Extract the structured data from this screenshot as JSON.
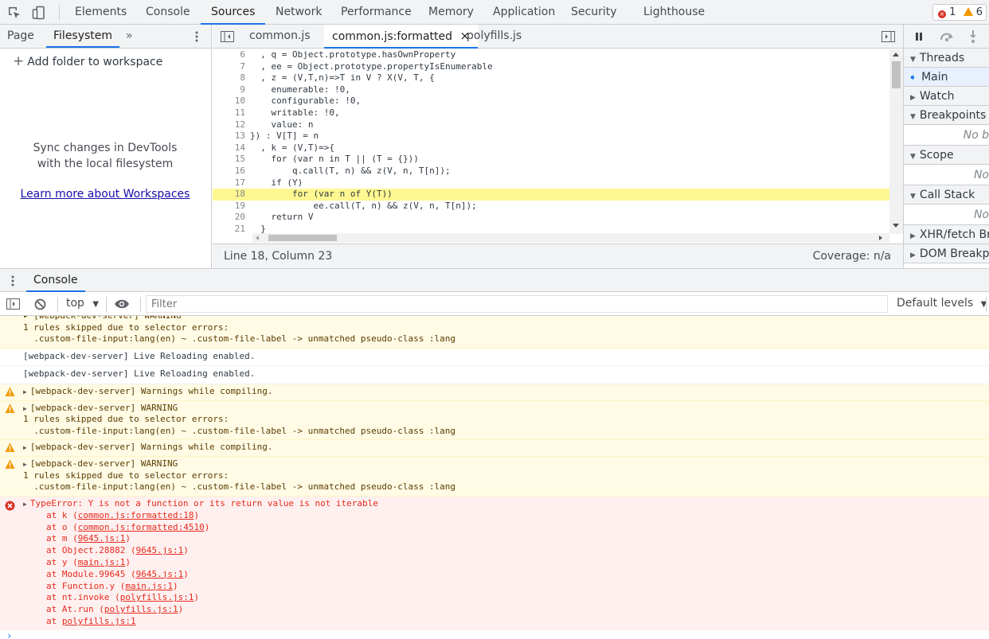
{
  "top_tabs": [
    "Elements",
    "Console",
    "Sources",
    "Network",
    "Performance",
    "Memory",
    "Application",
    "Security",
    "Lighthouse"
  ],
  "issues": {
    "errors": "1",
    "warnings": "6"
  },
  "navigator": {
    "tabs": [
      "Page",
      "Filesystem"
    ],
    "more": "»",
    "add_folder": "Add folder to workspace",
    "sync_line1": "Sync changes in DevTools",
    "sync_line2": "with the local filesystem",
    "learn_more": "Learn more about Workspaces"
  },
  "editor": {
    "tabs": [
      "common.js",
      "common.js:formatted",
      "polyfills.js"
    ],
    "close_glyph": "×",
    "highlighted_line": "18",
    "lines": [
      {
        "n": "6",
        "code": "  , q = Object.prototype.hasOwnProperty"
      },
      {
        "n": "7",
        "code": "  , ee = Object.prototype.propertyIsEnumerable"
      },
      {
        "n": "8",
        "code": "  , z = (V,T,n)=>T in V ? X(V, T, {"
      },
      {
        "n": "9",
        "code": "    enumerable: !0,"
      },
      {
        "n": "10",
        "code": "    configurable: !0,"
      },
      {
        "n": "11",
        "code": "    writable: !0,"
      },
      {
        "n": "12",
        "code": "    value: n"
      },
      {
        "n": "13",
        "code": "}) : V[T] = n"
      },
      {
        "n": "14",
        "code": "  , k = (V,T)=>{"
      },
      {
        "n": "15",
        "code": "    for (var n in T || (T = {}))"
      },
      {
        "n": "16",
        "code": "        q.call(T, n) && z(V, n, T[n]);"
      },
      {
        "n": "17",
        "code": "    if (Y)"
      },
      {
        "n": "18",
        "code": "        for (var n of Y(T))"
      },
      {
        "n": "19",
        "code": "            ee.call(T, n) && z(V, n, T[n]);"
      },
      {
        "n": "20",
        "code": "    return V"
      },
      {
        "n": "21",
        "code": "  }"
      }
    ],
    "status_position": "Line 18, Column 23",
    "coverage": "Coverage: n/a"
  },
  "debugger": {
    "sections": [
      {
        "title": "Threads",
        "expanded": true,
        "body": "Main"
      },
      {
        "title": "Watch",
        "expanded": false,
        "body": ""
      },
      {
        "title": "Breakpoints",
        "expanded": true,
        "body": "No b"
      },
      {
        "title": "Scope",
        "expanded": true,
        "body": "No"
      },
      {
        "title": "Call Stack",
        "expanded": true,
        "body": "No"
      },
      {
        "title": "XHR/fetch Br",
        "expanded": false,
        "body": ""
      },
      {
        "title": "DOM Breakpo",
        "expanded": false,
        "body": ""
      }
    ]
  },
  "drawer": {
    "tab": "Console"
  },
  "console_toolbar": {
    "context": "top",
    "filter_placeholder": "Filter",
    "levels": "Default levels"
  },
  "messages": [
    {
      "level": "warn",
      "icon": false,
      "lines": [
        "▸ [webpack-dev-server] WARNING",
        "1 rules skipped due to selector errors:",
        "  .custom-file-input:lang(en) ~ .custom-file-label -> unmatched pseudo-class :lang"
      ]
    },
    {
      "level": "log",
      "lines": [
        "[webpack-dev-server] Live Reloading enabled."
      ]
    },
    {
      "level": "log",
      "lines": [
        "[webpack-dev-server] Live Reloading enabled."
      ]
    },
    {
      "level": "warn",
      "icon": true,
      "lines": [
        "[webpack-dev-server] Warnings while compiling."
      ]
    },
    {
      "level": "warn",
      "icon": true,
      "lines": [
        "[webpack-dev-server] WARNING",
        "1 rules skipped due to selector errors:",
        "  .custom-file-input:lang(en) ~ .custom-file-label -> unmatched pseudo-class :lang"
      ]
    },
    {
      "level": "warn",
      "icon": true,
      "lines": [
        "[webpack-dev-server] Warnings while compiling."
      ]
    },
    {
      "level": "warn",
      "icon": true,
      "lines": [
        "[webpack-dev-server] WARNING",
        "1 rules skipped due to selector errors:",
        "  .custom-file-input:lang(en) ~ .custom-file-label -> unmatched pseudo-class :lang"
      ]
    }
  ],
  "error": {
    "message": "TypeError: Y is not a function or its return value is not iterable",
    "stack": [
      {
        "at": "at k (",
        "link": "common.js:formatted:18",
        "end": ")"
      },
      {
        "at": "at o (",
        "link": "common.js:formatted:4510",
        "end": ")"
      },
      {
        "at": "at m (",
        "link": "9645.js:1",
        "end": ")"
      },
      {
        "at": "at Object.28882 (",
        "link": "9645.js:1",
        "end": ")"
      },
      {
        "at": "at y (",
        "link": "main.js:1",
        "end": ")"
      },
      {
        "at": "at Module.99645 (",
        "link": "9645.js:1",
        "end": ")"
      },
      {
        "at": "at Function.y (",
        "link": "main.js:1",
        "end": ")"
      },
      {
        "at": "at nt.invoke (",
        "link": "polyfills.js:1",
        "end": ")"
      },
      {
        "at": "at At.run (",
        "link": "polyfills.js:1",
        "end": ")"
      },
      {
        "at": "at ",
        "link": "polyfills.js:1",
        "end": ""
      }
    ]
  },
  "colors": {
    "accent": "#1a73e8",
    "error": "#d93025",
    "warning": "#f29900",
    "highlight": "#fff791"
  }
}
